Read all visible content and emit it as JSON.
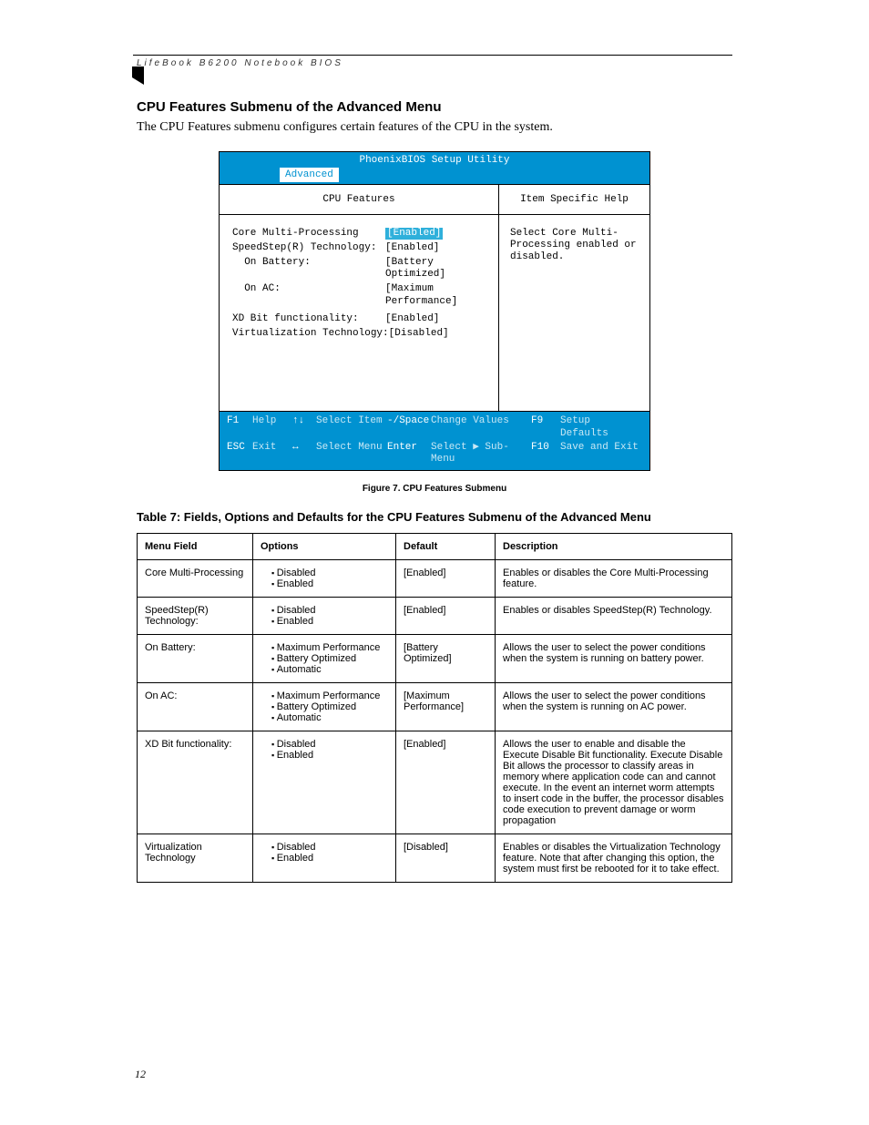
{
  "header_text": "LifeBook B6200 Notebook BIOS",
  "title": "CPU Features Submenu of the Advanced Menu",
  "intro": "The CPU Features submenu configures certain features of the CPU in the system.",
  "bios": {
    "utility_title": "PhoenixBIOS Setup Utility",
    "active_tab": "Advanced",
    "left_heading": "CPU Features",
    "right_heading": "Item Specific Help",
    "rows": [
      {
        "label": "Core Multi-Processing",
        "value": "[Enabled]",
        "selected": true
      },
      {
        "label": "SpeedStep(R) Technology:",
        "value": "[Enabled]"
      },
      {
        "label": "  On Battery:",
        "value": "[Battery Optimized]"
      },
      {
        "label": "  On AC:",
        "value": "[Maximum Performance]"
      },
      {
        "label": "",
        "value": ""
      },
      {
        "label": "XD Bit functionality:",
        "value": "[Enabled]"
      },
      {
        "label": "Virtualization Technology:",
        "value": "[Disabled]"
      }
    ],
    "help_text": "Select Core Multi-Processing enabled or disabled.",
    "footer": {
      "f1": "F1",
      "help": "Help",
      "ud": "↑↓",
      "select_item": "Select Item",
      "ms": "-/Space",
      "change": "Change Values",
      "f9": "F9",
      "defaults": "Setup Defaults",
      "esc": "ESC",
      "exit": "Exit",
      "lr": "↔",
      "select_menu": "Select Menu",
      "enter": "Enter",
      "sub": "Select ▶ Sub-Menu",
      "f10": "F10",
      "save": "Save and Exit"
    }
  },
  "figure_caption": "Figure 7.  CPU Features Submenu",
  "table_caption": "Table 7: Fields, Options and Defaults for the CPU Features Submenu of the Advanced Menu",
  "thead": {
    "c1": "Menu Field",
    "c2": "Options",
    "c3": "Default",
    "c4": "Description"
  },
  "trows": [
    {
      "field": "Core Multi-Processing",
      "options": [
        "Disabled",
        "Enabled"
      ],
      "def": "[Enabled]",
      "desc": "Enables or disables the Core Multi-Processing feature."
    },
    {
      "field": "SpeedStep(R) Technology:",
      "options": [
        "Disabled",
        "Enabled"
      ],
      "def": "[Enabled]",
      "desc": "Enables or disables SpeedStep(R) Technology."
    },
    {
      "field": "On Battery:",
      "options": [
        "Maximum Performance",
        "Battery Optimized",
        "Automatic"
      ],
      "def": "[Battery Optimized]",
      "desc": "Allows the user to select the power conditions when the system is running on battery power."
    },
    {
      "field": "On AC:",
      "options": [
        "Maximum Performance",
        "Battery Optimized",
        "Automatic"
      ],
      "def": "[Maximum Performance]",
      "desc": "Allows the user to select the power conditions when the system is running on AC power."
    },
    {
      "field": "XD Bit functionality:",
      "options": [
        "Disabled",
        "Enabled"
      ],
      "def": "[Enabled]",
      "desc": "Allows the user to enable and disable the Execute Disable Bit functionality.  Execute Disable Bit allows the processor to classify areas in memory where application code can and cannot execute. In the event an internet worm attempts to insert code in the buffer, the processor disables code execution to prevent damage or worm propagation"
    },
    {
      "field": "Virtualization Technology",
      "options": [
        "Disabled",
        "Enabled"
      ],
      "def": "[Disabled]",
      "desc": "Enables or disables the Virtualization Technology feature. Note that after changing this option, the system must first be rebooted for it to take effect."
    }
  ],
  "page_number": "12"
}
